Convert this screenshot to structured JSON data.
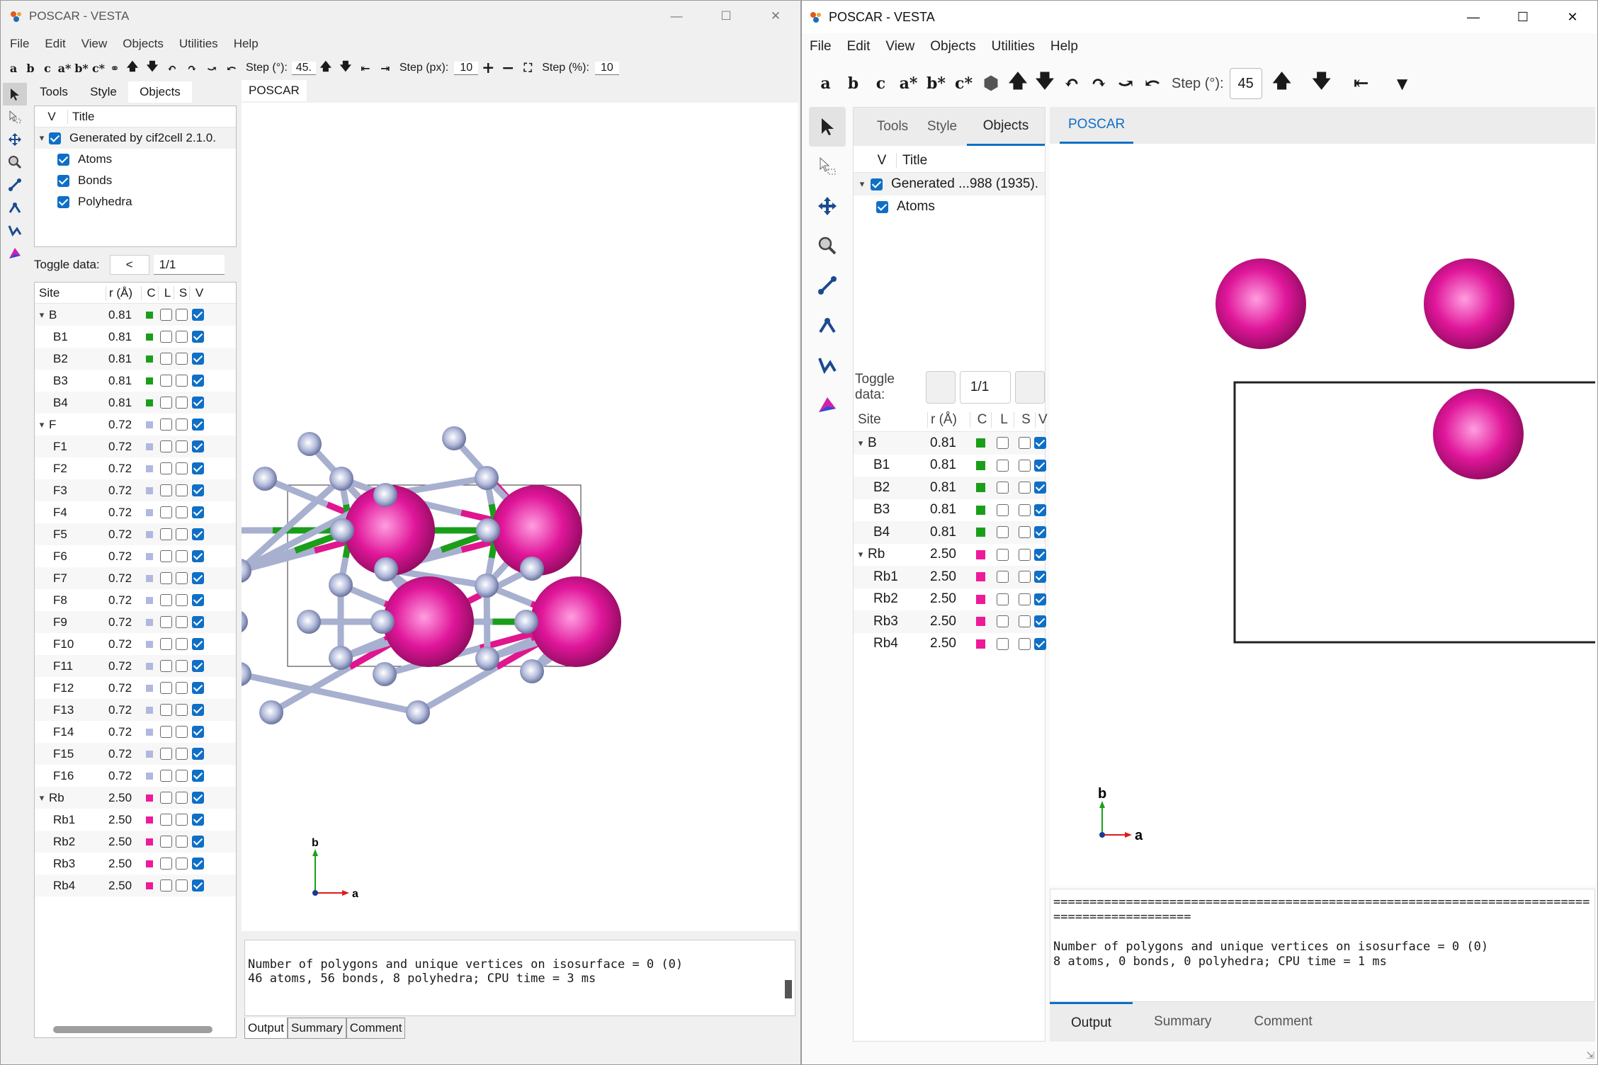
{
  "left": {
    "title": "POSCAR - VESTA",
    "menu": [
      "File",
      "Edit",
      "View",
      "Objects",
      "Utilities",
      "Help"
    ],
    "toolbar": {
      "axis_buttons": [
        "a",
        "b",
        "c",
        "a*",
        "b*",
        "c*"
      ],
      "step_deg_label": "Step (°):",
      "step_deg": "45.",
      "step_px_label": "Step (px):",
      "step_px": "10",
      "step_pct_label": "Step (%):",
      "step_pct": "10"
    },
    "tabs": [
      "Tools",
      "Style",
      "Objects"
    ],
    "view_tab": "POSCAR",
    "objects_header": {
      "v": "V",
      "title": "Title"
    },
    "objects": [
      {
        "label": "Generated by cif2cell 2.1.0.",
        "level": 0
      },
      {
        "label": "Atoms",
        "level": 1
      },
      {
        "label": "Bonds",
        "level": 1
      },
      {
        "label": "Polyhedra",
        "level": 1
      }
    ],
    "toggle": {
      "label": "Toggle data:",
      "button": "<",
      "value": "1/1"
    },
    "site_header": [
      "Site",
      "r (Å)",
      "C",
      "L",
      "S",
      "V"
    ],
    "sites": [
      {
        "name": "B",
        "r": "0.81",
        "color": "#1a9e1a",
        "group": true
      },
      {
        "name": "B1",
        "r": "0.81",
        "color": "#1a9e1a"
      },
      {
        "name": "B2",
        "r": "0.81",
        "color": "#1a9e1a"
      },
      {
        "name": "B3",
        "r": "0.81",
        "color": "#1a9e1a"
      },
      {
        "name": "B4",
        "r": "0.81",
        "color": "#1a9e1a"
      },
      {
        "name": "F",
        "r": "0.72",
        "color": "#b0b8e0",
        "group": true
      },
      {
        "name": "F1",
        "r": "0.72",
        "color": "#b0b8e0"
      },
      {
        "name": "F2",
        "r": "0.72",
        "color": "#b0b8e0"
      },
      {
        "name": "F3",
        "r": "0.72",
        "color": "#b0b8e0"
      },
      {
        "name": "F4",
        "r": "0.72",
        "color": "#b0b8e0"
      },
      {
        "name": "F5",
        "r": "0.72",
        "color": "#b0b8e0"
      },
      {
        "name": "F6",
        "r": "0.72",
        "color": "#b0b8e0"
      },
      {
        "name": "F7",
        "r": "0.72",
        "color": "#b0b8e0"
      },
      {
        "name": "F8",
        "r": "0.72",
        "color": "#b0b8e0"
      },
      {
        "name": "F9",
        "r": "0.72",
        "color": "#b0b8e0"
      },
      {
        "name": "F10",
        "r": "0.72",
        "color": "#b0b8e0"
      },
      {
        "name": "F11",
        "r": "0.72",
        "color": "#b0b8e0"
      },
      {
        "name": "F12",
        "r": "0.72",
        "color": "#b0b8e0"
      },
      {
        "name": "F13",
        "r": "0.72",
        "color": "#b0b8e0"
      },
      {
        "name": "F14",
        "r": "0.72",
        "color": "#b0b8e0"
      },
      {
        "name": "F15",
        "r": "0.72",
        "color": "#b0b8e0"
      },
      {
        "name": "F16",
        "r": "0.72",
        "color": "#b0b8e0"
      },
      {
        "name": "Rb",
        "r": "2.50",
        "color": "#ee1a9a",
        "group": true
      },
      {
        "name": "Rb1",
        "r": "2.50",
        "color": "#ee1a9a"
      },
      {
        "name": "Rb2",
        "r": "2.50",
        "color": "#ee1a9a"
      },
      {
        "name": "Rb3",
        "r": "2.50",
        "color": "#ee1a9a"
      },
      {
        "name": "Rb4",
        "r": "2.50",
        "color": "#ee1a9a"
      }
    ],
    "output": [
      "Number of polygons and unique vertices on isosurface = 0 (0)",
      "46 atoms, 56 bonds, 8 polyhedra; CPU time = 3 ms"
    ],
    "bottom_tabs": [
      "Output",
      "Summary",
      "Comment"
    ],
    "axes": {
      "x": "a",
      "y": "b"
    }
  },
  "right": {
    "title": "POSCAR - VESTA",
    "menu": [
      "File",
      "Edit",
      "View",
      "Objects",
      "Utilities",
      "Help"
    ],
    "toolbar": {
      "axis_buttons": [
        "a",
        "b",
        "c",
        "a*",
        "b*",
        "c*"
      ],
      "step_deg_label": "Step (°):",
      "step_deg": "45"
    },
    "tabs": [
      "Tools",
      "Style",
      "Objects"
    ],
    "view_tab": "POSCAR",
    "objects_header": {
      "v": "V",
      "title": "Title"
    },
    "objects": [
      {
        "label": "Generated ...988 (1935).",
        "level": 0
      },
      {
        "label": "Atoms",
        "level": 1
      }
    ],
    "toggle": {
      "label": "Toggle data:",
      "value": "1/1"
    },
    "site_header": [
      "Site",
      "r (Å)",
      "C",
      "L",
      "S",
      "V"
    ],
    "sites": [
      {
        "name": "B",
        "r": "0.81",
        "color": "#1a9e1a",
        "group": true
      },
      {
        "name": "B1",
        "r": "0.81",
        "color": "#1a9e1a"
      },
      {
        "name": "B2",
        "r": "0.81",
        "color": "#1a9e1a"
      },
      {
        "name": "B3",
        "r": "0.81",
        "color": "#1a9e1a"
      },
      {
        "name": "B4",
        "r": "0.81",
        "color": "#1a9e1a"
      },
      {
        "name": "Rb",
        "r": "2.50",
        "color": "#ee1a9a",
        "group": true
      },
      {
        "name": "Rb1",
        "r": "2.50",
        "color": "#ee1a9a"
      },
      {
        "name": "Rb2",
        "r": "2.50",
        "color": "#ee1a9a"
      },
      {
        "name": "Rb3",
        "r": "2.50",
        "color": "#ee1a9a"
      },
      {
        "name": "Rb4",
        "r": "2.50",
        "color": "#ee1a9a"
      }
    ],
    "output": [
      "==========================================================================",
      "===================",
      "",
      "Number of polygons and unique vertices on isosurface = 0 (0)",
      "8 atoms, 0 bonds, 0 polyhedra; CPU time = 1 ms"
    ],
    "bottom_tabs": [
      "Output",
      "Summary",
      "Comment"
    ],
    "axes": {
      "x": "a",
      "y": "b"
    }
  },
  "colors": {
    "accent": "#0f6fc6",
    "rb": "#ee1a9a",
    "b": "#1a9e1a",
    "f": "#b0b8e0"
  }
}
